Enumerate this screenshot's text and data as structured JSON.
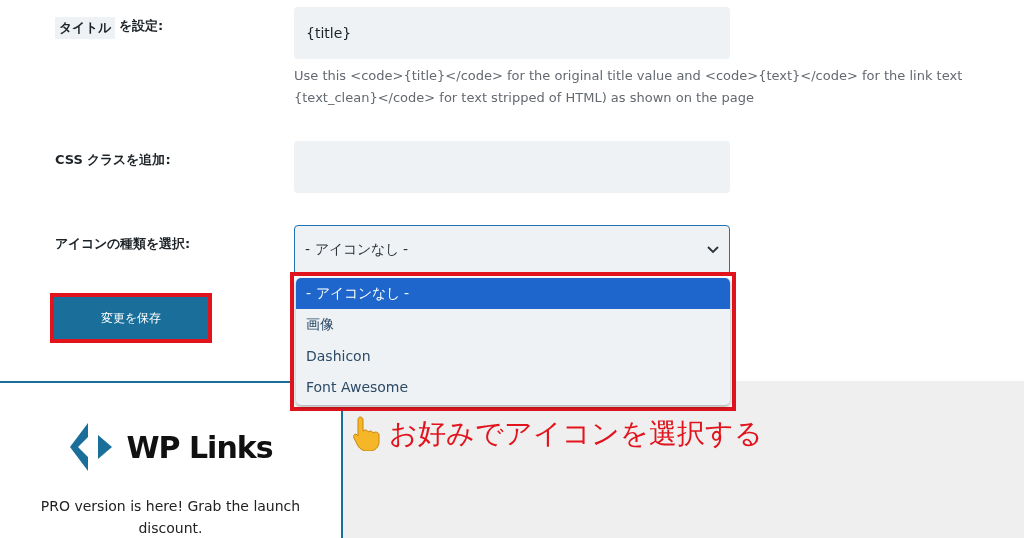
{
  "title_row": {
    "label_highlight": "タイトル",
    "label_rest": "を設定:",
    "value": "{title}",
    "help_lines": [
      "Use this <code>{title}</code> for the original title value and <code>{text}</code> for the link text",
      "{text_clean}</code> for text stripped of HTML) as shown on the page"
    ]
  },
  "css_row": {
    "label": "CSS クラスを追加:"
  },
  "icon_row": {
    "label": "アイコンの種類を選択:",
    "value": "- アイコンなし -",
    "expanded": true,
    "options": [
      {
        "label": "- アイコンなし -",
        "selected": true
      },
      {
        "label": "画像",
        "selected": false
      },
      {
        "label": "Dashicon",
        "selected": false
      },
      {
        "label": "Font Awesome",
        "selected": false
      }
    ]
  },
  "save_button": "変更を保存",
  "promo": {
    "logo": "WP Links",
    "text": "PRO version is here! Grab the launch discount."
  },
  "annotation": "お好みでアイコンを選択する"
}
